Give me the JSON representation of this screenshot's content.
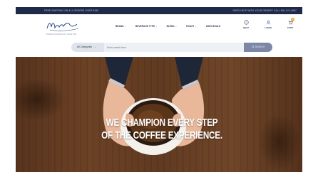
{
  "topbar": {
    "left": "FREE SHIPPING ON ALL ORDERS OVER $150",
    "right": "NEED HELP WITH YOUR ORDER? CALL 800-123-4567"
  },
  "logo": {
    "tagline": "COFFEE ROASTERS EST. SINCE 1995"
  },
  "nav": [
    {
      "label": "BRAND"
    },
    {
      "label": "BEVERAGE TYPE"
    },
    {
      "label": "BLEND"
    },
    {
      "label": "ROAST"
    },
    {
      "label": "WHOLESALE"
    }
  ],
  "header_icons": {
    "help": "HELP",
    "login": "LOGIN",
    "cart": "CART",
    "cart_count": "0"
  },
  "search": {
    "category": "All Categories",
    "placeholder": "Enter search term",
    "button": "SEARCH"
  },
  "hero": {
    "line1": "WE CHAMPION EVERY STEP",
    "line2": "OF THE COFFEE EXPERIENCE."
  },
  "colors": {
    "topbar_bg": "#1e2a47",
    "search_button": "#7c87a8",
    "badge": "#f5a623"
  }
}
